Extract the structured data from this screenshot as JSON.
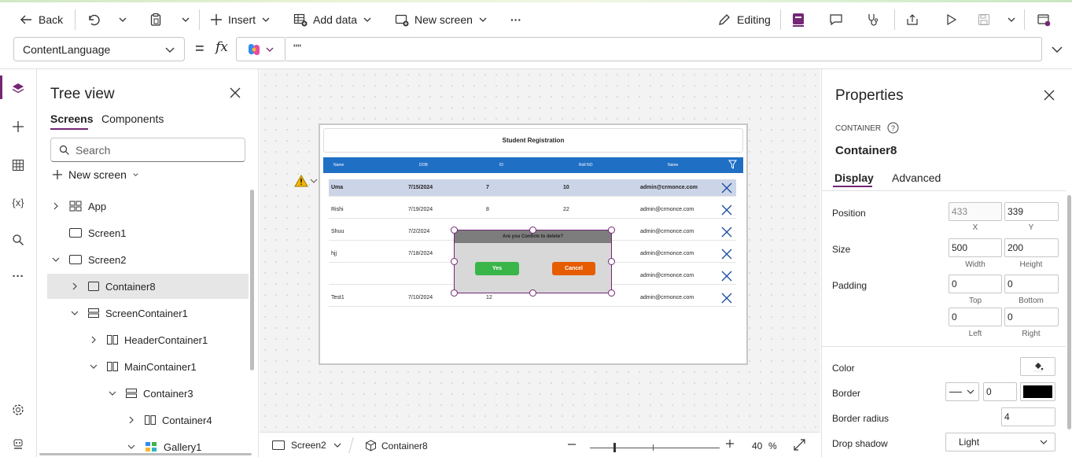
{
  "toolbar": {
    "back": "Back",
    "insert": "Insert",
    "add_data": "Add data",
    "new_screen": "New screen",
    "more": "···",
    "editing": "Editing"
  },
  "formula": {
    "property": "ContentLanguage",
    "equals": "=",
    "fx": "fx",
    "value": "\"\""
  },
  "tree": {
    "title": "Tree view",
    "tabs": [
      "Screens",
      "Components"
    ],
    "search_placeholder": "Search",
    "new_screen": "New screen",
    "items": [
      {
        "label": "App",
        "icon": "app-icon",
        "chevron": "right",
        "level": 0
      },
      {
        "label": "Screen1",
        "icon": "screen-icon",
        "chevron": "",
        "level": 0
      },
      {
        "label": "Screen2",
        "icon": "screen-icon",
        "chevron": "down",
        "level": 0
      },
      {
        "label": "Container8",
        "icon": "container-icon",
        "chevron": "right",
        "level": 1,
        "selected": true
      },
      {
        "label": "ScreenContainer1",
        "icon": "vertical-container-icon",
        "chevron": "down",
        "level": 1
      },
      {
        "label": "HeaderContainer1",
        "icon": "horizontal-container-icon",
        "chevron": "right",
        "level": 2
      },
      {
        "label": "MainContainer1",
        "icon": "horizontal-container-icon",
        "chevron": "down",
        "level": 2
      },
      {
        "label": "Container3",
        "icon": "vertical-container-icon",
        "chevron": "down",
        "level": 3
      },
      {
        "label": "Container4",
        "icon": "horizontal-container-icon",
        "chevron": "right",
        "level": 4
      },
      {
        "label": "Gallery1",
        "icon": "gallery-icon",
        "chevron": "down",
        "level": 4
      }
    ]
  },
  "app": {
    "title": "Student Registration",
    "headers": [
      "Name",
      "DOB",
      "ID",
      "Roll NO",
      "Name"
    ],
    "rows": [
      {
        "name": "Uma",
        "dob": "7/15/2024",
        "id": "7",
        "roll": "10",
        "email": "admin@crmonce.com",
        "bold": true
      },
      {
        "name": "Rishi",
        "dob": "7/19/2024",
        "id": "8",
        "roll": "22",
        "email": "admin@crmonce.com"
      },
      {
        "name": "Shuu",
        "dob": "7/2/2024",
        "id": "",
        "roll": "",
        "email": "admin@crmonce.com"
      },
      {
        "name": "hjj",
        "dob": "7/18/2024",
        "id": "",
        "roll": "",
        "email": "admin@crmonce.com"
      },
      {
        "name": "",
        "dob": "",
        "id": "",
        "roll": "",
        "email": "admin@crmonce.com"
      },
      {
        "name": "Test1",
        "dob": "7/10/2024",
        "id": "12",
        "roll": "",
        "email": "admin@crmonce.com"
      }
    ],
    "dialog": {
      "question": "Are you Confirm to delete?",
      "yes": "Yes",
      "cancel": "Cancel"
    }
  },
  "status": {
    "screen": "Screen2",
    "control": "Container8",
    "zoom": "40",
    "percent": "%"
  },
  "properties": {
    "title": "Properties",
    "type": "CONTAINER",
    "name": "Container8",
    "tabs": [
      "Display",
      "Advanced"
    ],
    "position_label": "Position",
    "x": "433",
    "y": "339",
    "x_label": "X",
    "y_label": "Y",
    "size_label": "Size",
    "width": "500",
    "height": "200",
    "width_label": "Width",
    "height_label": "Height",
    "padding_label": "Padding",
    "top": "0",
    "bottom": "0",
    "left": "0",
    "right": "0",
    "top_label": "Top",
    "bottom_label": "Bottom",
    "left_label": "Left",
    "right_label": "Right",
    "color_label": "Color",
    "border_label": "Border",
    "border_width": "0",
    "border_color": "#000000",
    "border_radius_label": "Border radius",
    "border_radius": "4",
    "drop_shadow_label": "Drop shadow",
    "drop_shadow": "Light"
  },
  "colors": {
    "accent": "#742774",
    "header_blue": "#1f6fc5",
    "yes_green": "#3ab54a",
    "cancel_orange": "#e65c00",
    "selected_row": "#ccd5e8"
  }
}
